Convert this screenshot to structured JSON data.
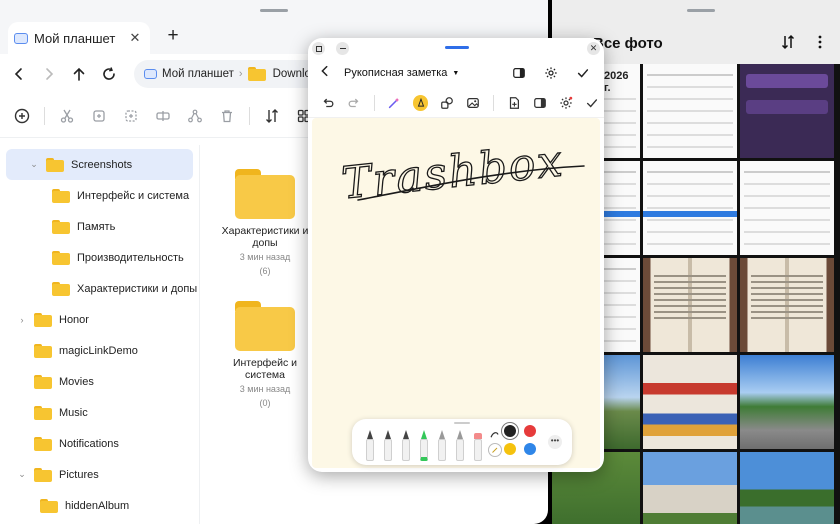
{
  "file_manager": {
    "tab": {
      "label": "Мой планшет"
    },
    "path": {
      "root": "Мой планшет",
      "current": "Download"
    },
    "tree": [
      {
        "label": "Screenshots",
        "level": 1,
        "expanded": true,
        "selected": true
      },
      {
        "label": "Интерфейс и система",
        "level": 2
      },
      {
        "label": "Память",
        "level": 2
      },
      {
        "label": "Производительность",
        "level": 2
      },
      {
        "label": "Характеристики и допы",
        "level": 2
      },
      {
        "label": "Honor",
        "level": 0,
        "collapsed": true
      },
      {
        "label": "magicLinkDemo",
        "level": 0
      },
      {
        "label": "Movies",
        "level": 0
      },
      {
        "label": "Music",
        "level": 0
      },
      {
        "label": "Notifications",
        "level": 0
      },
      {
        "label": "Pictures",
        "level": 0,
        "expanded": true
      },
      {
        "label": "hiddenAlbum",
        "level": 1
      }
    ],
    "folders": [
      {
        "name": "Характеристики и допы",
        "time": "3 мин назад",
        "count": "(6)"
      },
      {
        "name": "Интерфейс и система",
        "time": "3 мин назад",
        "count": "(0)"
      }
    ]
  },
  "note": {
    "title": "Рукописная заметка",
    "handwriting": "Trashbox",
    "colors": [
      "#222222",
      "#e63b3b",
      "#f5c20e",
      "#2f86e8"
    ]
  },
  "gallery": {
    "title": "Все фото",
    "peek_text": "2026 г."
  },
  "theme": {
    "accent": "#2f6ee8",
    "folder": "#f8c947"
  }
}
